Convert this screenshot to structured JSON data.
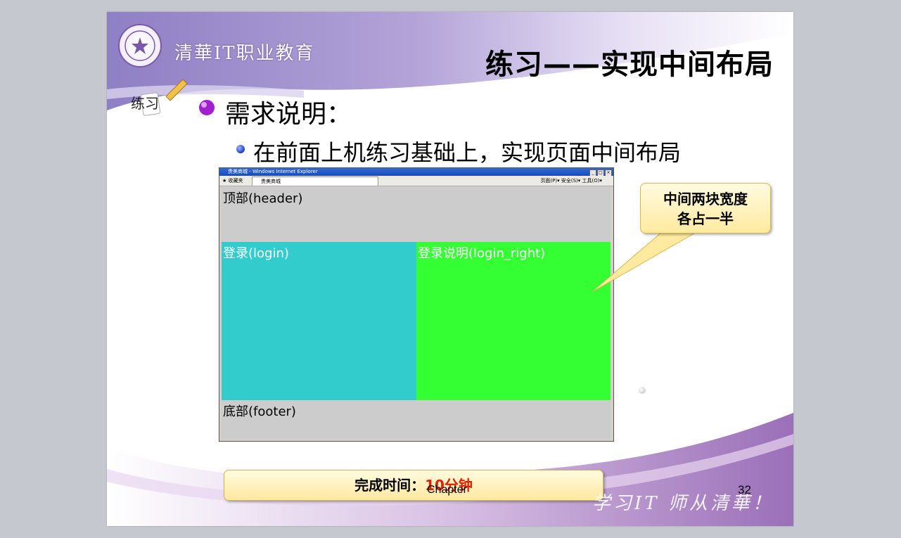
{
  "slide": {
    "logo_text": "清華IT职业教育",
    "title": "练习——实现中间布局",
    "practice_label": "练习",
    "heading": "需求说明：",
    "subheading": "在前面上机练习基础上，实现页面中间布局"
  },
  "browser": {
    "window_title": "贵美商城 - Windows Internet Explorer",
    "favorites_label": "收藏夹",
    "tab_label": "贵美商城",
    "toolbar_right": "页面(P)▾ 安全(S)▾ 工具(O)▾",
    "sections": {
      "header": "顶部(header)",
      "login": "登录(login)",
      "login_right": "登录说明(login_right)",
      "footer": "底部(footer)"
    }
  },
  "callout": {
    "line1": "中间两块宽度",
    "line2": "各占一半"
  },
  "time_box": {
    "label": "完成时间：",
    "value": "10分钟"
  },
  "footer": {
    "chapter": "Chapter",
    "page_number": "32",
    "motto": "学习IT 师从清華！"
  },
  "colors": {
    "header_bg": "#cccccc",
    "login_bg": "#33cccc",
    "login_right_bg": "#33ff33",
    "footer_bg": "#cccccc",
    "time_value": "#e02000"
  }
}
